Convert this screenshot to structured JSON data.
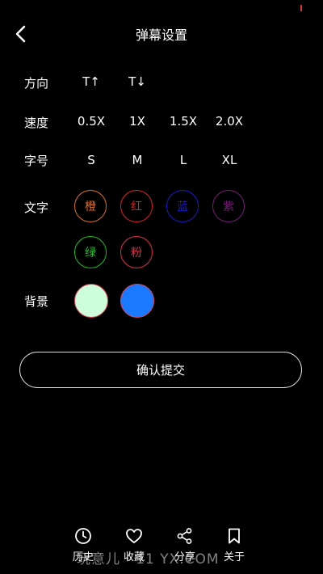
{
  "header": {
    "title": "弹幕设置"
  },
  "direction": {
    "label": "方向",
    "options": [
      "T↑",
      "T↓"
    ]
  },
  "speed": {
    "label": "速度",
    "options": [
      "0.5X",
      "1X",
      "1.5X",
      "2.0X"
    ]
  },
  "font_size": {
    "label": "字号",
    "options": [
      "S",
      "M",
      "L",
      "XL"
    ]
  },
  "text_color": {
    "label": "文字",
    "options": [
      {
        "label": "橙",
        "color": "#e07020"
      },
      {
        "label": "红",
        "color": "#e02020"
      },
      {
        "label": "蓝",
        "color": "#1a1acc"
      },
      {
        "label": "紫",
        "color": "#7a1a7a"
      },
      {
        "label": "绿",
        "color": "#20c020"
      },
      {
        "label": "粉",
        "color": "#e0304a"
      }
    ]
  },
  "background": {
    "label": "背景",
    "options": [
      {
        "name": "light-green",
        "color": "#ccffd9"
      },
      {
        "name": "blue",
        "color": "#1a7aff"
      }
    ]
  },
  "submit_label": "确认提交",
  "tabs": [
    {
      "label": "历史",
      "icon": "clock-icon"
    },
    {
      "label": "收藏",
      "icon": "heart-icon"
    },
    {
      "label": "分享",
      "icon": "share-icon"
    },
    {
      "label": "关于",
      "icon": "bookmark-icon"
    }
  ],
  "watermark": "玩意儿 · 11 YX.COM"
}
